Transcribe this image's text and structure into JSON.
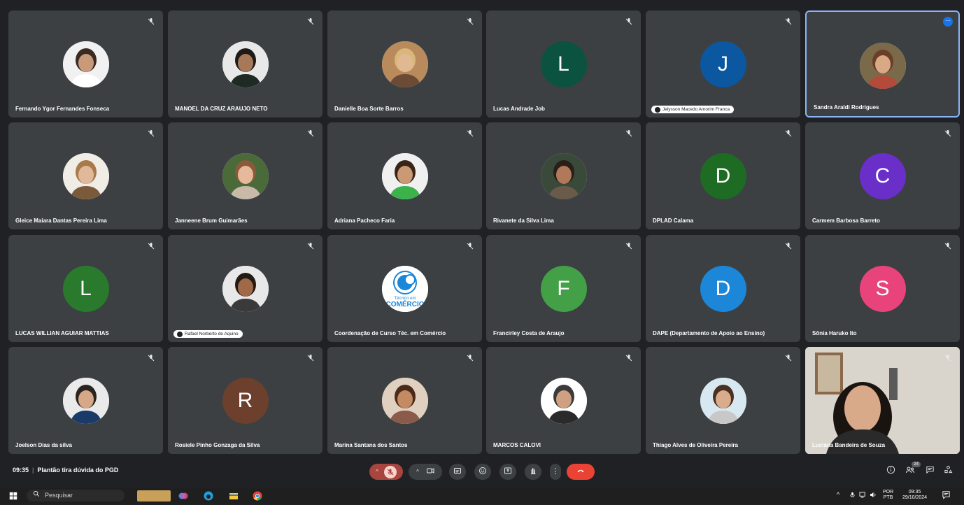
{
  "participants": [
    {
      "name": "Fernando Ygor Fernandes Fonseca",
      "type": "photo",
      "skin": "#c99a7a",
      "hair": "#3a2a22",
      "bg": "#f1f1f1",
      "shirt": "#ffffff"
    },
    {
      "name": "MANOEL DA CRUZ ARAUJO NETO",
      "type": "photo",
      "skin": "#a8785a",
      "hair": "#1e1a18",
      "bg": "#e8e8e8",
      "shirt": "#1f2a24"
    },
    {
      "name": "Danielle Boa Sorte Barros",
      "type": "photo",
      "skin": "#e0b892",
      "hair": "#d9b77a",
      "bg": "#b88a5c",
      "shirt": "#6b4b36"
    },
    {
      "name": "Lucas Andrade Job",
      "type": "letter",
      "letter": "L",
      "color": "#0b5240"
    },
    {
      "name": "",
      "type": "letter",
      "letter": "J",
      "color": "#0b57a0",
      "pill": "Jelysson Macedo Amorim Franca"
    },
    {
      "name": "Sandra Araldi Rodrigues",
      "type": "photo",
      "skin": "#d9a884",
      "hair": "#6b3e28",
      "bg": "#7a6a4a",
      "shirt": "#b44a3a",
      "speaking": true
    },
    {
      "name": "Gleice Maiara Dantas Pereira Lima",
      "type": "photo",
      "skin": "#e0b89a",
      "hair": "#a87a4a",
      "bg": "#f0ece6",
      "shirt": "#7a5a3a"
    },
    {
      "name": "Janneene Brum Guimarães",
      "type": "photo",
      "skin": "#e6b89c",
      "hair": "#8a5a3a",
      "bg": "#4a6a3a",
      "shirt": "#c9b9a9"
    },
    {
      "name": "Adriana Pacheco Faria",
      "type": "photo",
      "skin": "#c99a74",
      "hair": "#3a2418",
      "bg": "#f0f0f0",
      "shirt": "#3bb34a"
    },
    {
      "name": "Rivanete da Silva Lima",
      "type": "photo",
      "skin": "#b07a5a",
      "hair": "#2a1e18",
      "bg": "#3a4a3a",
      "shirt": "#6a5a4a"
    },
    {
      "name": "DPLAD Calama",
      "type": "letter",
      "letter": "D",
      "color": "#1e6b24"
    },
    {
      "name": "Carmem Barbosa Barreto",
      "type": "letter",
      "letter": "C",
      "color": "#6a2fc8"
    },
    {
      "name": "LUCAS WILLIAN AGUIAR MATTIAS",
      "type": "letter",
      "letter": "L",
      "color": "#2a7a2e"
    },
    {
      "name": "",
      "type": "photo",
      "skin": "#a06a48",
      "hair": "#241a14",
      "bg": "#e8e8e8",
      "shirt": "#3a3a3a",
      "pill": "Rafael Norberto de Aquino"
    },
    {
      "name": "Coordenação de Curso Téc. em Comércio",
      "type": "logo",
      "logo_text": "Técnico em",
      "logo_text2": "COMÉRCIO"
    },
    {
      "name": "Francirley Costa de Araujo",
      "type": "letter",
      "letter": "F",
      "color": "#43a047"
    },
    {
      "name": "DAPE (Departamento de Apoio ao Ensino)",
      "type": "letter",
      "letter": "D",
      "color": "#1c86d8"
    },
    {
      "name": "Sônia Haruko Ito",
      "type": "letter",
      "letter": "S",
      "color": "#e8437a"
    },
    {
      "name": "Joelson Dias da silva",
      "type": "photo",
      "skin": "#d7a888",
      "hair": "#2a2420",
      "bg": "#eaeaea",
      "shirt": "#1a3a6a"
    },
    {
      "name": "Rosiele Pinho Gonzaga da Silva",
      "type": "letter",
      "letter": "R",
      "color": "#6d3f2d"
    },
    {
      "name": "Marina Santana dos Santos",
      "type": "photo",
      "skin": "#c48a64",
      "hair": "#4a2a18",
      "bg": "#e0d0c0",
      "shirt": "#8a5a4a"
    },
    {
      "name": "MARCOS CALOVI",
      "type": "photo",
      "skin": "#d0a082",
      "hair": "#3a3a3a",
      "bg": "#ffffff",
      "shirt": "#2a2a2a"
    },
    {
      "name": "Thiago Alves de Oliveira Pereira",
      "type": "photo",
      "skin": "#d9ac8c",
      "hair": "#4a3020",
      "bg": "#d8e8f0",
      "shirt": "#c8c8c8"
    },
    {
      "name": "Luciana Bandeira de Souza",
      "type": "video"
    }
  ],
  "bottom_bar": {
    "time": "09:35",
    "meeting_title": "Plantão tira dúvida do PGD",
    "people_count": "24"
  },
  "taskbar": {
    "search_placeholder": "Pesquisar",
    "lang_top": "POR",
    "lang_bottom": "PTB",
    "clock_time": "09:35",
    "clock_date": "29/10/2024"
  },
  "icons": {
    "mute": "mic-off-icon",
    "camera": "camera-icon",
    "captions": "captions-icon",
    "emoji": "emoji-icon",
    "present": "present-icon",
    "hand": "raise-hand-icon",
    "more": "more-vert-icon",
    "leave": "end-call-icon",
    "info": "info-icon",
    "people": "people-icon",
    "chat": "chat-icon",
    "activities": "activities-icon"
  },
  "colors": {
    "leave": "#ea4335",
    "mic_off": "#a8453e",
    "tile": "#3c4043",
    "bg": "#202124",
    "active_border": "#8ab4f8"
  }
}
